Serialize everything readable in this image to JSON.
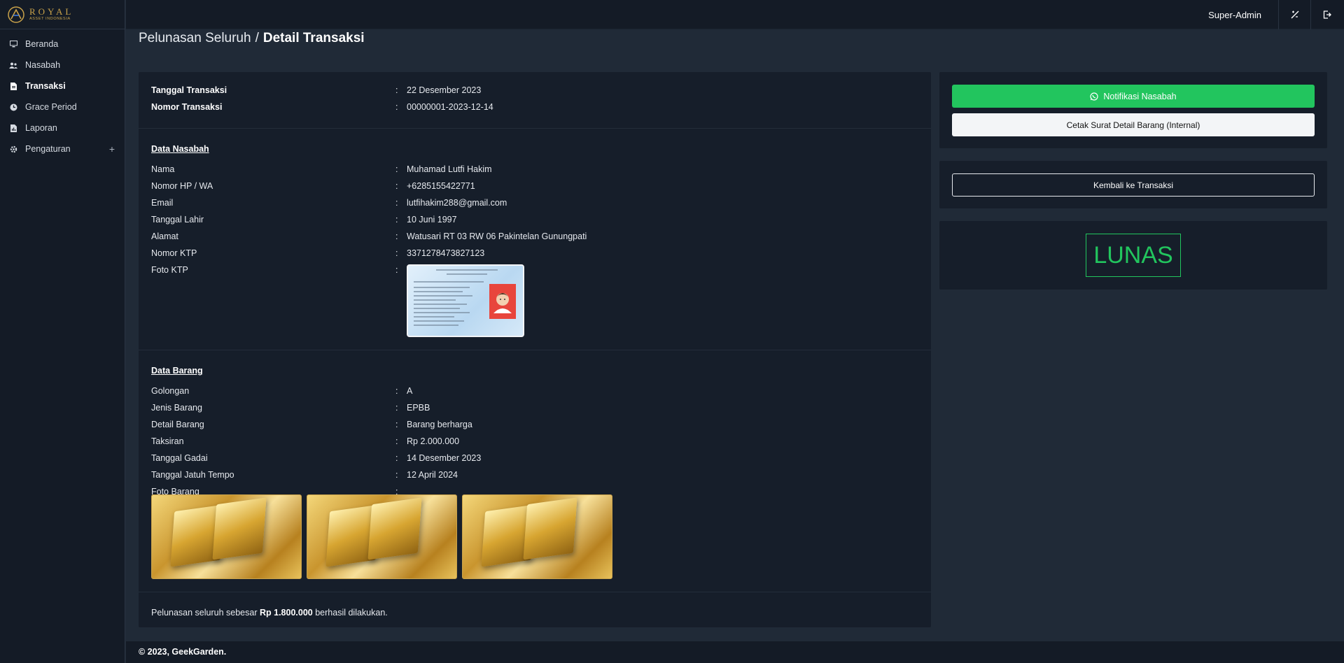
{
  "brand": {
    "name": "ROYAL",
    "tagline": "ASSET INDONESIA"
  },
  "sidebar": {
    "items": [
      {
        "label": "Beranda",
        "icon": "monitor-icon"
      },
      {
        "label": "Nasabah",
        "icon": "users-icon"
      },
      {
        "label": "Transaksi",
        "icon": "file-icon",
        "active": true
      },
      {
        "label": "Grace Period",
        "icon": "clock-icon"
      },
      {
        "label": "Laporan",
        "icon": "report-icon"
      },
      {
        "label": "Pengaturan",
        "icon": "gear-icon",
        "expand": "+"
      }
    ]
  },
  "topbar": {
    "user": "Super-Admin"
  },
  "header": {
    "breadcrumb": "Pelunasan Seluruh",
    "separator": "/",
    "title": "Detail Transaksi"
  },
  "transaction": {
    "date_label": "Tanggal Transaksi",
    "date_value": "22 Desember 2023",
    "number_label": "Nomor Transaksi",
    "number_value": "00000001-2023-12-14"
  },
  "customer": {
    "title": "Data Nasabah",
    "rows": [
      {
        "label": "Nama",
        "value": "Muhamad Lutfi Hakim"
      },
      {
        "label": "Nomor HP / WA",
        "value": "+6285155422771"
      },
      {
        "label": "Email",
        "value": "lutfihakim288@gmail.com"
      },
      {
        "label": "Tanggal Lahir",
        "value": "10 Juni 1997"
      },
      {
        "label": "Alamat",
        "value": "Watusari RT 03 RW 06 Pakintelan Gunungpati"
      },
      {
        "label": "Nomor KTP",
        "value": "3371278473827123"
      }
    ],
    "photo_label": "Foto KTP"
  },
  "item": {
    "title": "Data Barang",
    "rows": [
      {
        "label": "Golongan",
        "value": "A"
      },
      {
        "label": "Jenis Barang",
        "value": "EPBB"
      },
      {
        "label": "Detail Barang",
        "value": "Barang berharga"
      },
      {
        "label": "Taksiran",
        "value": "Rp 2.000.000"
      },
      {
        "label": "Tanggal Gadai",
        "value": "14 Desember 2023"
      },
      {
        "label": "Tanggal Jatuh Tempo",
        "value": "12 April 2024"
      }
    ],
    "photo_label": "Foto Barang"
  },
  "colon": ":",
  "settlement": {
    "prefix": "Pelunasan seluruh sebesar",
    "amount": "Rp 1.800.000",
    "suffix": "berhasil dilakukan."
  },
  "actions": {
    "notify": "Notifikasi Nasabah",
    "print": "Cetak Surat Detail Barang (Internal)",
    "back": "Kembali ke Transaksi"
  },
  "status": {
    "label": "LUNAS",
    "color": "#22c55e"
  },
  "footer": {
    "copyright": "© 2023, GeekGarden."
  }
}
